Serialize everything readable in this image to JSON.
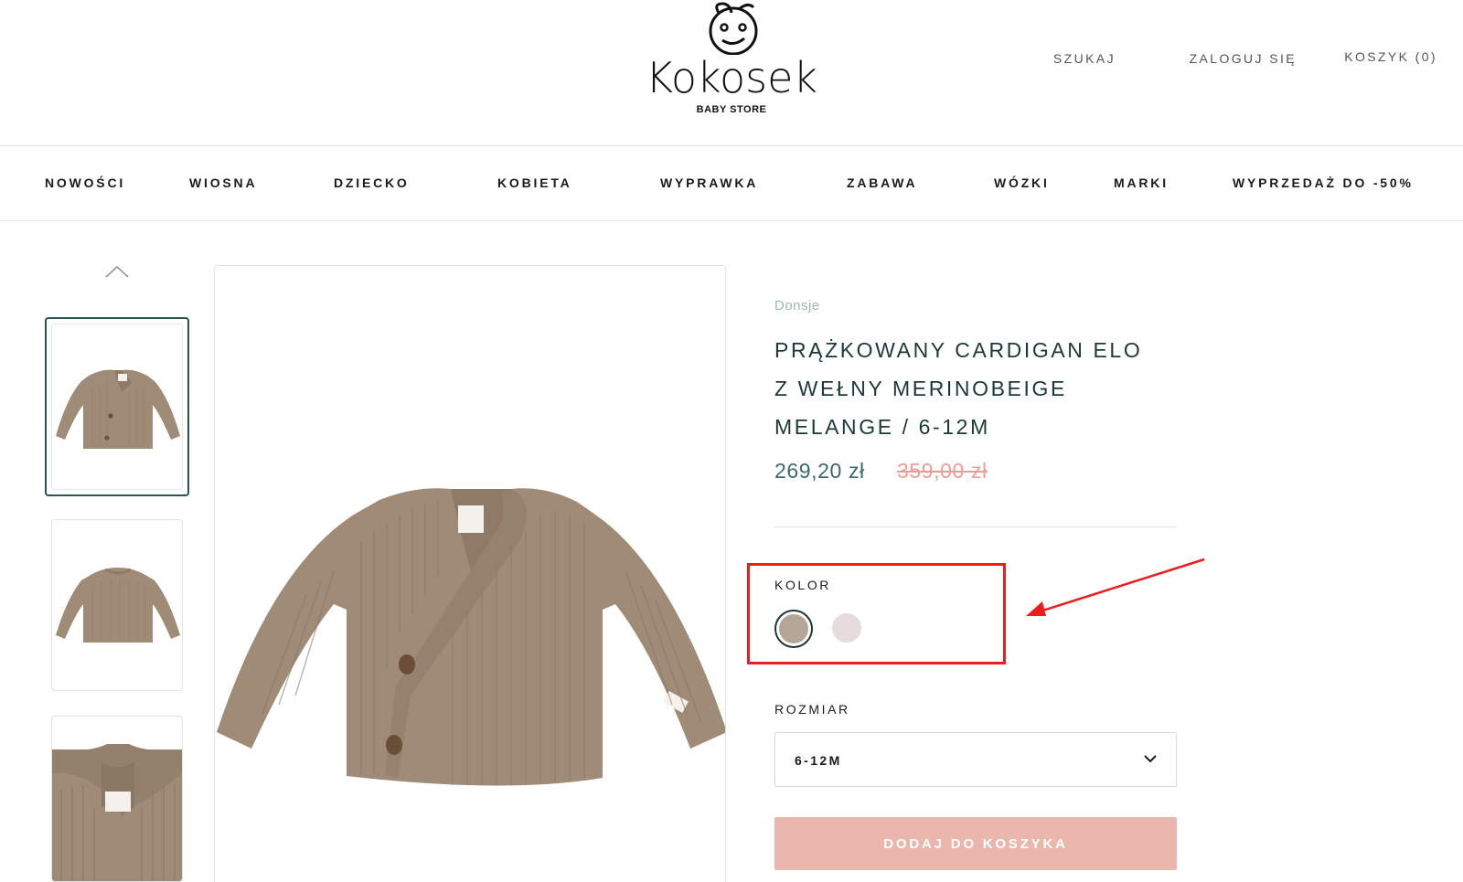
{
  "header": {
    "logo_text": "Kokosek",
    "logo_sub": "BABY STORE",
    "links": [
      "SZUKAJ",
      "ZALOGUJ SIĘ",
      "KOSZYK (0)"
    ]
  },
  "nav": {
    "items": [
      "NOWOŚCI",
      "WIOSNA",
      "DZIECKO",
      "KOBIETA",
      "WYPRAWKA",
      "ZABAWA",
      "WÓZKI",
      "MARKI",
      "WYPRZEDAŻ DO -50%"
    ]
  },
  "gallery": {
    "thumbnails": [
      "cardigan-front",
      "cardigan-back",
      "cardigan-detail"
    ],
    "active_index": 0
  },
  "product": {
    "brand": "Donsje",
    "title_lines": [
      "PRĄŻKOWANY CARDIGAN ELO",
      "Z WEŁNY MERINOBEIGE",
      "MELANGE / 6-12M"
    ],
    "price": "269,20 zł",
    "compare_price": "359,00 zł",
    "color_label": "KOLOR",
    "swatches": [
      {
        "color": "#b5a696",
        "selected": true
      },
      {
        "color": "#e6dbdd",
        "selected": false
      }
    ],
    "size_label": "ROZMIAR",
    "size_value": "6-12M",
    "add_to_cart": "DODAJ DO KOSZYKA"
  },
  "colors": {
    "accent": "#2b5650",
    "brand_text": "#9bb9ae",
    "price": "#3c6b62",
    "sale_strike": "#ee9c95",
    "cart_button": "#ebb7ad",
    "annotation": "#ee1c1c",
    "product_wool": "#a08b77"
  }
}
